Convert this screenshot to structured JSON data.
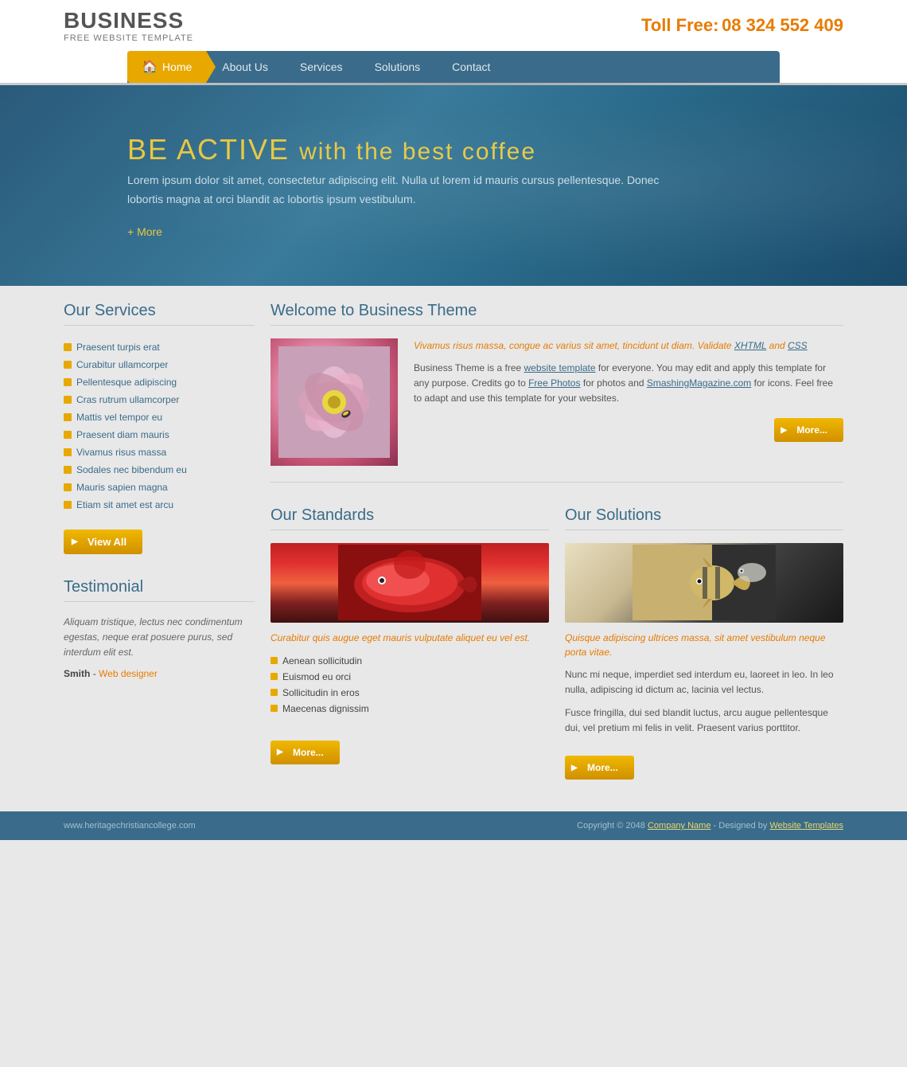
{
  "header": {
    "logo": {
      "title": "BUSINESS",
      "subtitle": "FREE WEBSITE TEMPLATE"
    },
    "toll_free_label": "Toll Free:",
    "toll_free_number": "08 324 552 409"
  },
  "nav": {
    "home": "Home",
    "about": "About Us",
    "services": "Services",
    "solutions": "Solutions",
    "contact": "Contact"
  },
  "hero": {
    "headline_white": "BE ACTIVE",
    "headline_yellow": "with the best coffee",
    "description": "Lorem ipsum dolor sit amet, consectetur adipiscing elit. Nulla ut lorem id mauris cursus pellentesque. Donec lobortis magna at orci blandit ac lobortis ipsum vestibulum.",
    "more_link": "+ More"
  },
  "our_services": {
    "title": "Our Services",
    "items": [
      "Praesent turpis erat",
      "Curabitur ullamcorper",
      "Pellentesque adipiscing",
      "Cras rutrum ullamcorper",
      "Mattis vel tempor eu",
      "Praesent diam mauris",
      "Vivamus risus massa",
      "Sodales nec bibendum eu",
      "Mauris sapien magna",
      "Etiam sit amet est arcu"
    ],
    "view_all_label": "View All"
  },
  "testimonial": {
    "title": "Testimonial",
    "text": "Aliquam tristique, lectus nec condimentum egestas, neque erat posuere purus, sed interdum elit est.",
    "author": "Smith",
    "author_role": "Web designer"
  },
  "welcome": {
    "title": "Welcome to Business Theme",
    "italic_text": "Vivamus risus massa, congue ac varius sit amet, tincidunt ut diam. Validate ",
    "xhtml_link": "XHTML",
    "and_text": " and ",
    "css_link": "CSS",
    "body_text": "Business Theme is a free ",
    "website_template_link": "website template",
    "body_text2": " for everyone. You may edit and apply this template for any purpose. Credits go to ",
    "free_photos_link": "Free Photos",
    "body_text3": " for photos and ",
    "smashing_link": "SmashingMagazine.com",
    "body_text4": " for icons. Feel free to adapt and use this template for your websites.",
    "more_label": "More..."
  },
  "standards": {
    "title": "Our Standards",
    "italic_desc": "Curabitur quis augue eget mauris vulputate aliquet eu vel est.",
    "list_items": [
      "Aenean sollicitudin",
      "Euismod eu orci",
      "Sollicitudin in eros",
      "Maecenas dignissim"
    ],
    "more_label": "More..."
  },
  "solutions": {
    "title": "Our Solutions",
    "italic_desc": "Quisque adipiscing ultrices massa, sit amet vestibulum neque porta vitae.",
    "body1": "Nunc mi neque, imperdiet sed interdum eu, laoreet in leo. In leo nulla, adipiscing id dictum ac, lacinia vel lectus.",
    "body2": "Fusce fringilla, dui sed blandit luctus, arcu augue pellentesque dui, vel pretium mi felis in velit. Praesent varius porttitor.",
    "more_label": "More..."
  },
  "footer": {
    "left_text": "www.heritagechristiancollege.com",
    "copyright": "Copyright © 2048 ",
    "company_link": "Company Name",
    "designed_by": " - Designed by ",
    "website_templates_link": "Website Templates"
  }
}
